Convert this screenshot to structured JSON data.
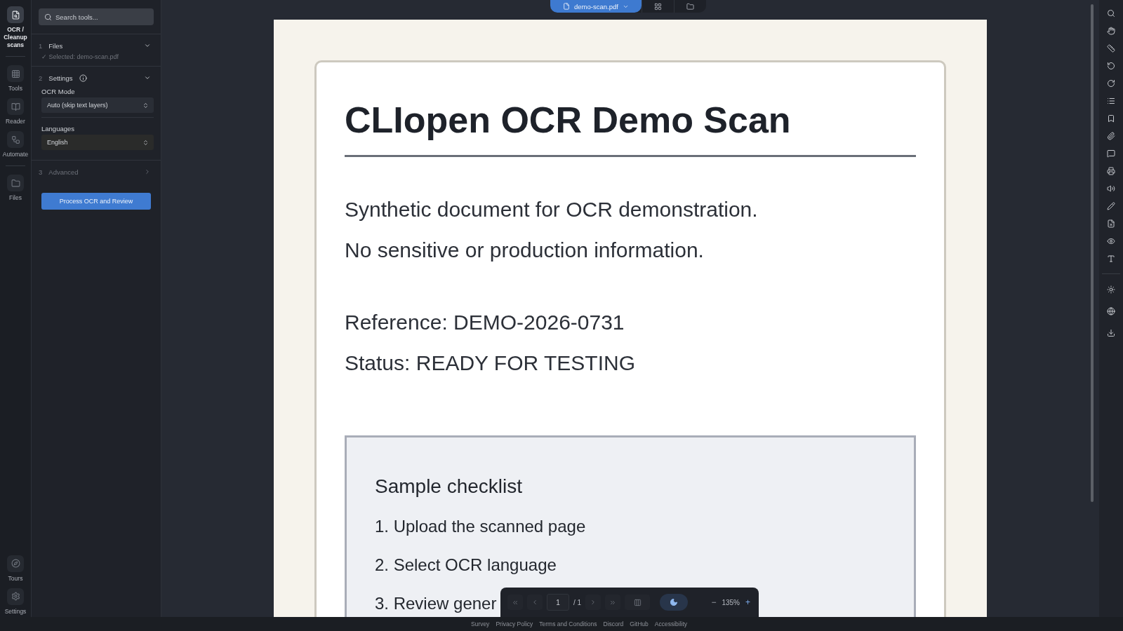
{
  "rail": {
    "items": [
      {
        "kind": "ocr",
        "label": "OCR / Cleanup scans",
        "selected": true
      },
      {
        "kind": "tools",
        "label": "Tools",
        "selected": false
      },
      {
        "kind": "reader",
        "label": "Reader",
        "selected": false
      },
      {
        "kind": "automate",
        "label": "Automate",
        "selected": false
      },
      {
        "kind": "files",
        "label": "Files",
        "selected": false
      }
    ],
    "bottom_items": [
      {
        "kind": "tours",
        "label": "Tours"
      },
      {
        "kind": "settings",
        "label": "Settings"
      }
    ]
  },
  "tool_panel": {
    "search": {
      "placeholder": "Search tools..."
    },
    "steps": [
      {
        "number": "1",
        "title": "Files",
        "expanded": true,
        "note": "✓ Selected: demo-scan.pdf"
      },
      {
        "number": "2",
        "title": "Settings",
        "expanded": true,
        "info": true,
        "fields": [
          {
            "label": "OCR Mode",
            "value": "Auto (skip text layers)"
          },
          {
            "label": "Languages",
            "value": "English"
          }
        ]
      },
      {
        "number": "3",
        "title": "Advanced",
        "expanded": false
      }
    ],
    "action": "Process OCR and Review"
  },
  "file_bar": {
    "file": "demo-scan.pdf"
  },
  "document": {
    "title": "CLIopen OCR Demo Scan",
    "lines": [
      "Synthetic document for OCR demonstration.",
      "No sensitive or production information."
    ],
    "fields": [
      "Reference: DEMO-2026-0731",
      "Status: READY FOR TESTING"
    ],
    "checklist": {
      "title": "Sample checklist",
      "items": [
        "1. Upload the scanned page",
        "2. Select OCR language",
        "3. Review gener"
      ]
    }
  },
  "viewer_toolbar": {
    "page": "1",
    "page_count": "/ 1",
    "dark_mode": true,
    "zoom": "135%",
    "minus": "−",
    "plus": "+"
  },
  "right_rail": {
    "tools": [
      {
        "kind": "search"
      },
      {
        "kind": "hand"
      },
      {
        "kind": "ruler"
      },
      {
        "kind": "rotate-left"
      },
      {
        "kind": "rotate-right"
      },
      {
        "kind": "list"
      },
      {
        "kind": "bookmark"
      },
      {
        "kind": "attachment"
      },
      {
        "kind": "comment"
      },
      {
        "kind": "print"
      },
      {
        "kind": "speaker"
      },
      {
        "kind": "pen"
      },
      {
        "kind": "file-remove"
      },
      {
        "kind": "eye"
      },
      {
        "kind": "text-size"
      }
    ],
    "extra": [
      {
        "kind": "sun"
      },
      {
        "kind": "globe"
      },
      {
        "kind": "download"
      }
    ]
  },
  "footer": {
    "links": [
      "Survey",
      "Privacy Policy",
      "Terms and Conditions",
      "Discord",
      "GitHub",
      "Accessibility"
    ]
  }
}
